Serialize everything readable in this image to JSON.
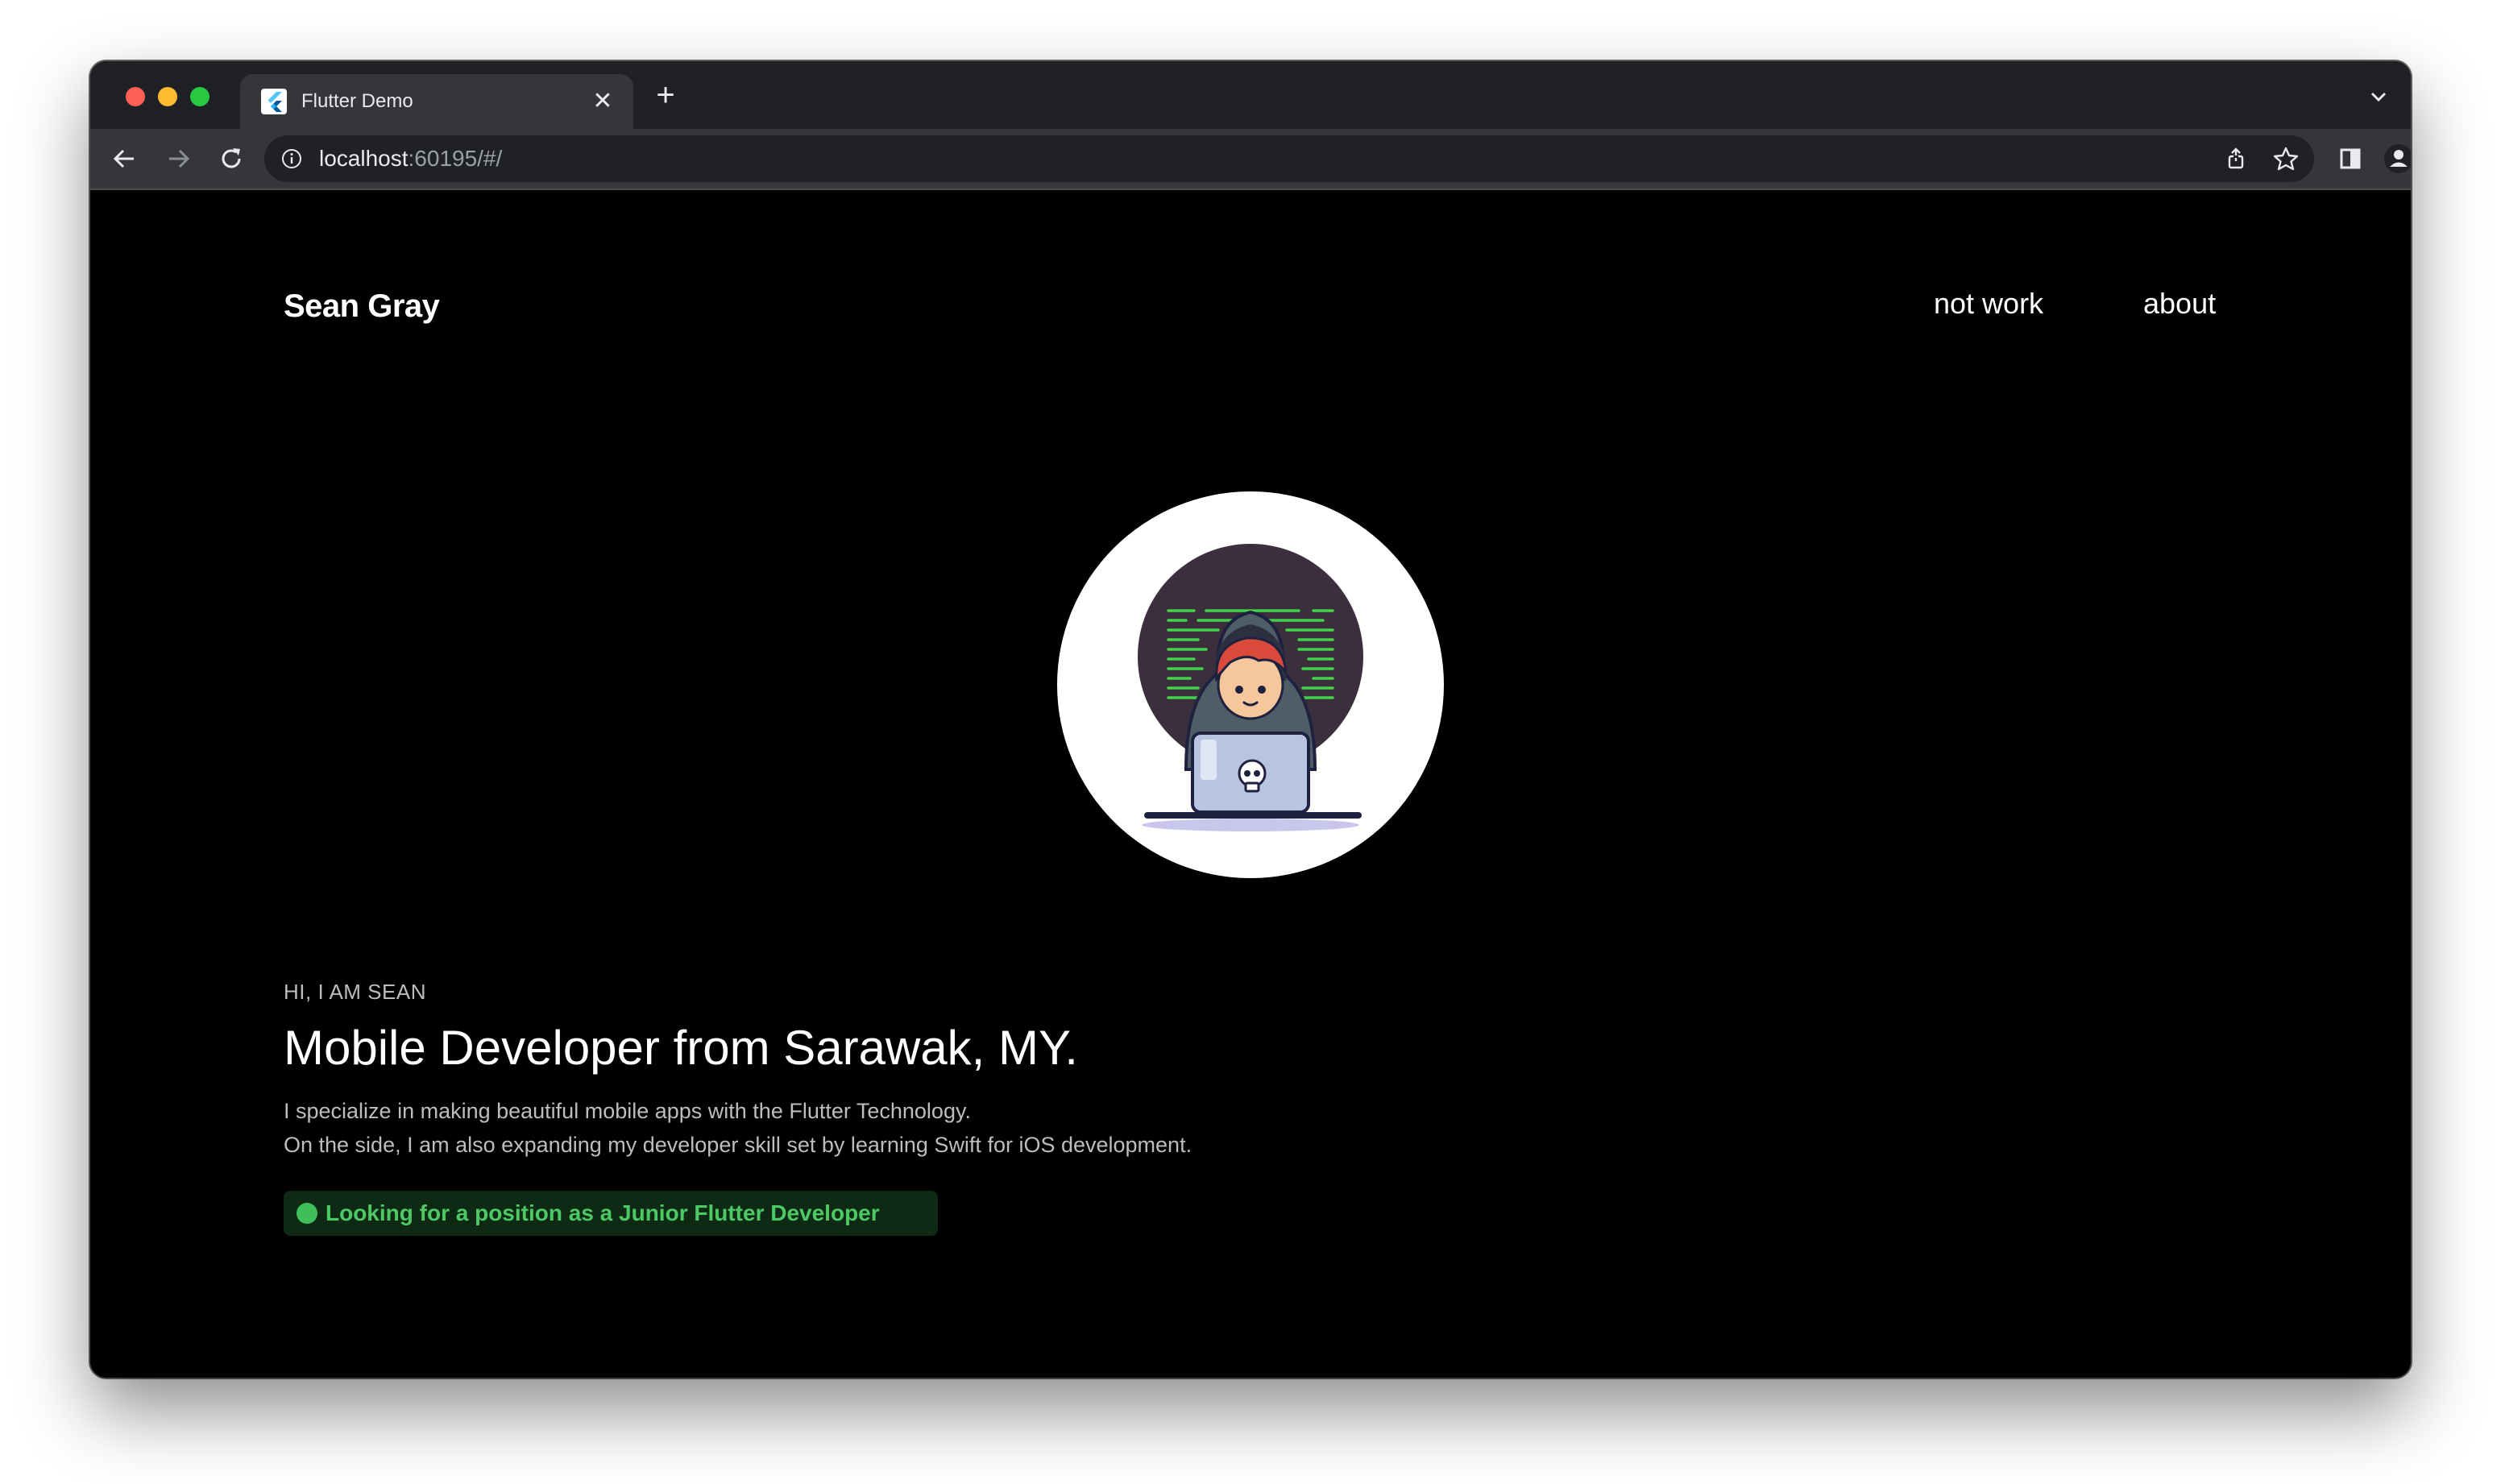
{
  "browser": {
    "tab_title": "Flutter Demo",
    "url_host": "localhost",
    "url_rest": ":60195/#/"
  },
  "site": {
    "brand": "Sean Gray",
    "nav": [
      {
        "label": "not work"
      },
      {
        "label": "about"
      }
    ]
  },
  "hero": {
    "greeting": "HI, I AM SEAN",
    "headline": "Mobile Developer from Sarawak, MY.",
    "bio_line_1": "I specialize in making beautiful mobile apps with the Flutter Technology.",
    "bio_line_2": "On the side, I am also expanding my developer skill set by learning Swift for iOS development.",
    "status": "Looking for a position as a Junior Flutter Developer"
  },
  "colors": {
    "status_green": "#3fbf5a",
    "status_bg": "#0f2a14",
    "page_bg": "#000000"
  }
}
